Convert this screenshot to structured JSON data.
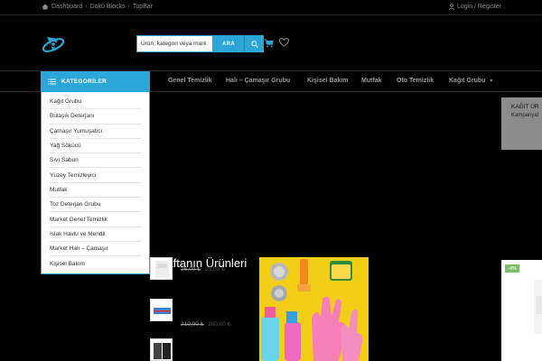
{
  "topbar": {
    "breadcrumbs": [
      "Dashboard",
      "Dokü Blocks",
      "TopBar"
    ],
    "login_text": "Login / Register"
  },
  "search": {
    "placeholder": "Ürün, kategori veya mark",
    "button_label": "ARA"
  },
  "nav": {
    "items": [
      "Genel Temizlik",
      "Halı – Çamaşır Grubu",
      "Kişisel Bakım",
      "Mutfak",
      "Oto Temizlik",
      "Kağıt Grubu"
    ]
  },
  "categories": {
    "header": "KATEGORİLER",
    "items": [
      "Kağıt Grubu",
      "Bulaşık Deterjanı",
      "Çamaşır Yumuşatıcı",
      "Yağ Sökücü",
      "Sıvı Sabun",
      "Yüzey Temizleyici",
      "Mutfak",
      "Toz Deterjan Grubu",
      "Market Genel Temizlik",
      "Islak Havlu ve Mendil",
      "Market Halı – Çamaşır",
      "Kişisel Bakım"
    ]
  },
  "promo": {
    "title": "KAĞIT ÜR",
    "subtitle": "Kampanyal"
  },
  "products": {
    "section_title": "Haftanın Ürünleri",
    "items": [
      {
        "old_price": "26,00 ₺",
        "new_price": "25,00 ₺"
      },
      {
        "old_price": "210,00 ₺",
        "new_price": "200,00 ₺"
      },
      {
        "old_price": "",
        "new_price": ""
      }
    ]
  },
  "right_card": {
    "badge": "-4%"
  },
  "colors": {
    "accent": "#2ba6d6",
    "background": "#000000",
    "badge": "#7cc26b"
  }
}
